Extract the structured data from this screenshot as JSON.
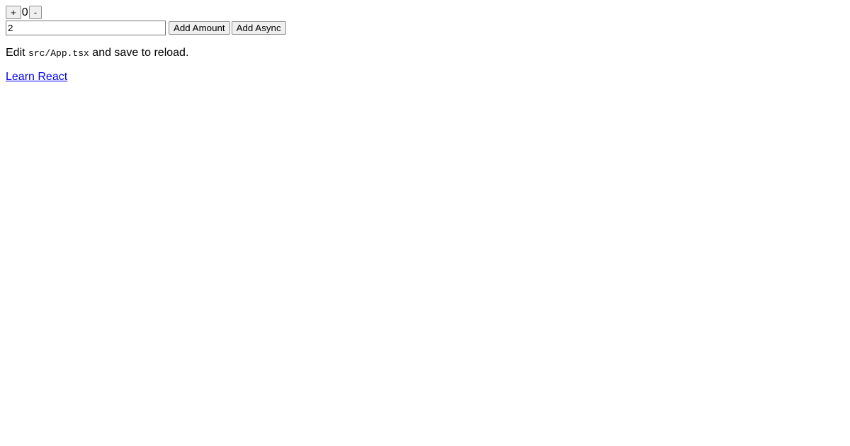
{
  "counter": {
    "increment_label": "+",
    "decrement_label": "-",
    "value": "0"
  },
  "amount": {
    "input_value": "2",
    "add_amount_label": "Add Amount",
    "add_async_label": "Add Async"
  },
  "instruction": {
    "prefix": "Edit ",
    "code": "src/App.tsx",
    "suffix": " and save to reload."
  },
  "link": {
    "learn_react_label": "Learn React"
  }
}
